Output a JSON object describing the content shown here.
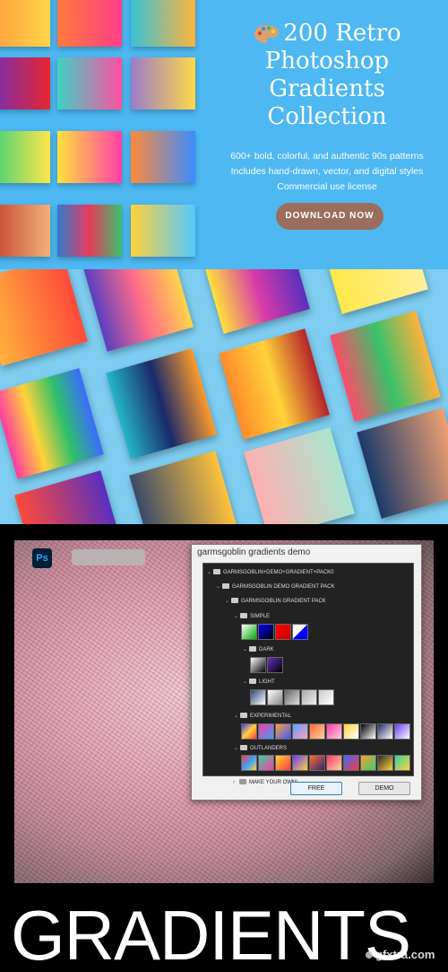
{
  "hero": {
    "title": "200 Retro Photoshop Gradients Collection",
    "palette_icon": "artist-palette-icon",
    "features": [
      "600+ bold, colorful, and authentic 90s patterns",
      "Includes hand-drawn, vector, and digital styles",
      "Commercial use license"
    ],
    "cta_label": "DOWNLOAD NOW"
  },
  "photoshop": {
    "app_badge": "Ps",
    "dialog_title": "garmsgoblin gradients demo",
    "tree": [
      {
        "label": "GARMSGOBLIN+DEMO+GRADIENT+PACK0"
      },
      {
        "label": "GARMSGOBLIN DEMO GRADIENT PACK"
      },
      {
        "label": "GARMSGOBLIN GRADIENT PACK"
      },
      {
        "label": "SIMPLE"
      },
      {
        "label": "DARK"
      },
      {
        "label": "LIGHT"
      },
      {
        "label": "EXPERIMENTAL"
      },
      {
        "label": "OUTLANDERS"
      },
      {
        "label": "MAKE YOUR OWN!"
      }
    ],
    "buttons": {
      "free": "FREE",
      "demo": "DEMO"
    },
    "headline": "GRADIENTS",
    "watermark": "gfxtra.com"
  },
  "colors": {
    "hero_bg": "#4db8f2",
    "cta_bg": "#9b6d5e",
    "tilted_bg": "#7ecdf0"
  }
}
